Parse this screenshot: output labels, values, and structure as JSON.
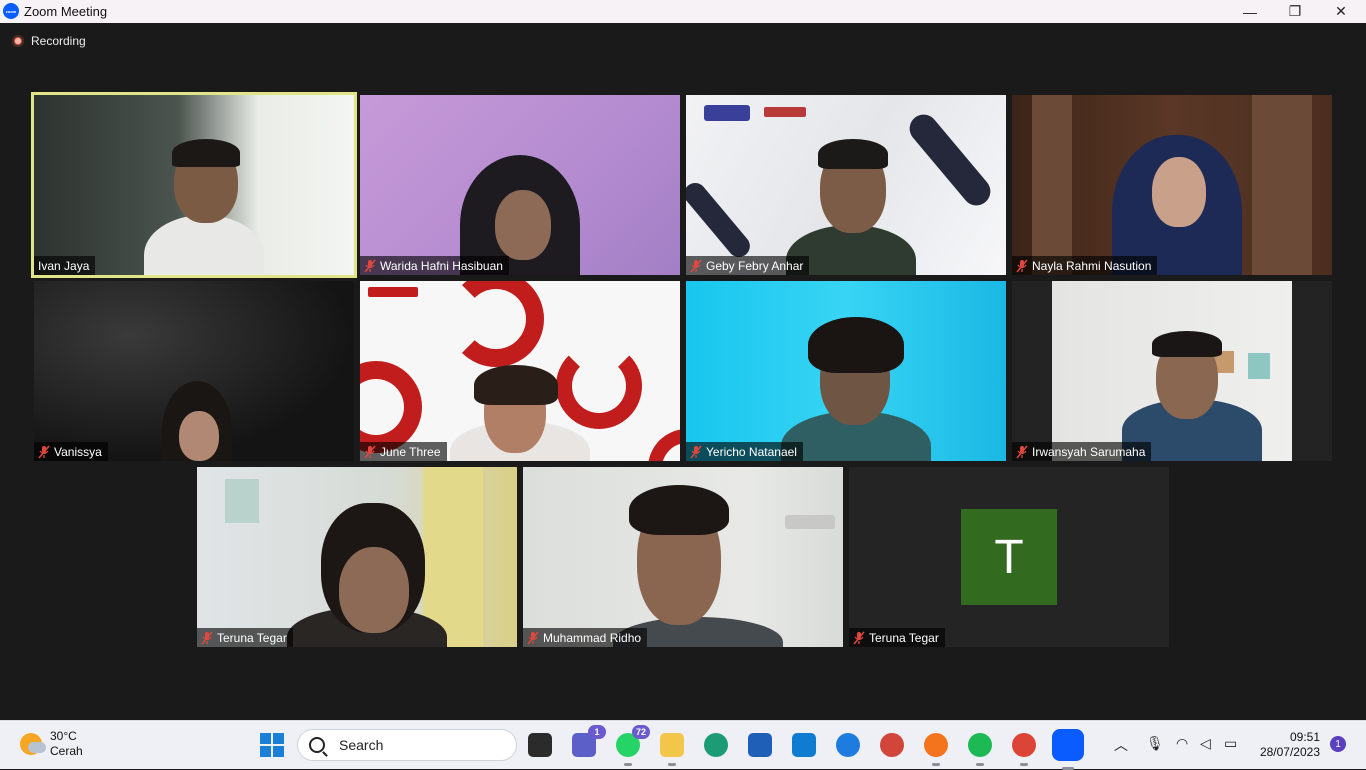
{
  "window": {
    "title": "Zoom Meeting",
    "controls": {
      "minimize": "—",
      "restore": "❐",
      "close": "✕"
    }
  },
  "recording": {
    "label": "Recording"
  },
  "participants": [
    {
      "name": "Ivan Jaya",
      "muted": false,
      "active": true
    },
    {
      "name": "Warida Hafni Hasibuan",
      "muted": true
    },
    {
      "name": "Geby Febry Anhar",
      "muted": true
    },
    {
      "name": "Nayla Rahmi Nasution",
      "muted": true
    },
    {
      "name": "Vanissya",
      "muted": true
    },
    {
      "name": "June Three",
      "muted": true
    },
    {
      "name": "Yericho Natanael",
      "muted": true
    },
    {
      "name": "Irwansyah Sarumaha",
      "muted": true
    },
    {
      "name": "Teruna Tegar",
      "muted": true
    },
    {
      "name": "Muhammad Ridho",
      "muted": true
    },
    {
      "name": "Teruna Tegar",
      "muted": true,
      "avatar_letter": "T"
    }
  ],
  "colors": {
    "active_border": "#dfe68a",
    "avatar_bg": "#326b1f",
    "recording": "#e2533f"
  },
  "taskbar": {
    "weather": {
      "temp": "30°C",
      "condition": "Cerah"
    },
    "search_placeholder": "Search",
    "badges": {
      "teams": "1",
      "whatsapp": "72"
    },
    "clock": {
      "time": "09:51",
      "date": "28/07/2023"
    },
    "notifications": "1"
  }
}
